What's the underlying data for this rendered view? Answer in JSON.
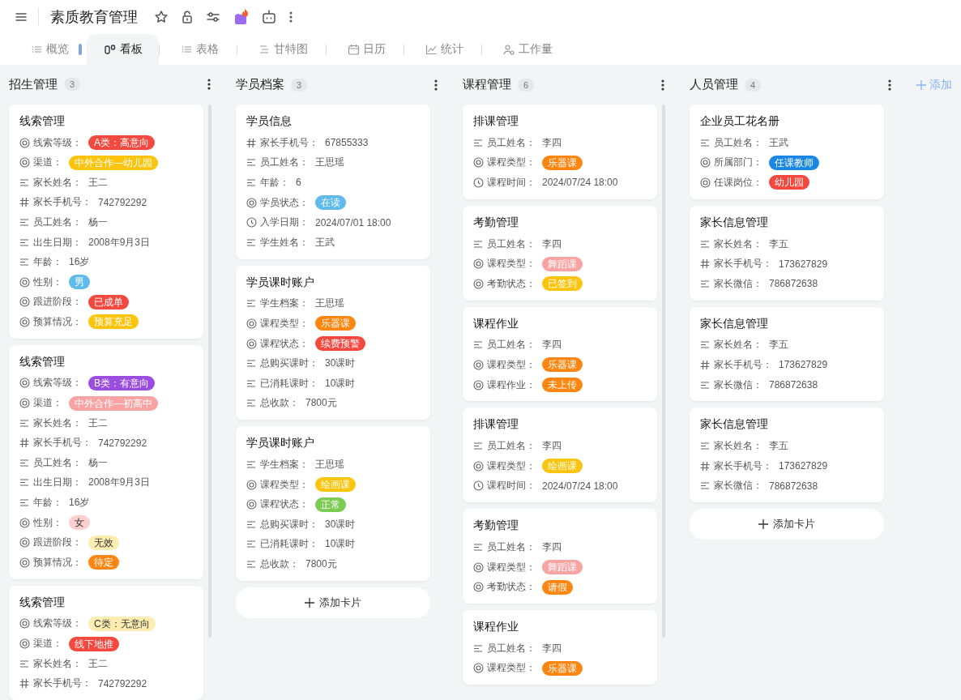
{
  "app": {
    "title": "素质教育管理"
  },
  "tabs": [
    {
      "label": "概览",
      "kind": "list",
      "selected": false
    },
    {
      "label": "看板",
      "kind": "board",
      "selected": true
    },
    {
      "label": "表格",
      "kind": "list",
      "selected": false
    },
    {
      "label": "甘特图",
      "kind": "gantt",
      "selected": false
    },
    {
      "label": "日历",
      "kind": "calendar",
      "selected": false
    },
    {
      "label": "统计",
      "kind": "chart",
      "selected": false
    },
    {
      "label": "工作量",
      "kind": "person",
      "selected": false
    }
  ],
  "columns": [
    {
      "title": "招生管理",
      "count": "3",
      "cards": [
        {
          "title": "线索管理",
          "fields": [
            {
              "kind": "select",
              "label": "线索等级：",
              "value": "A类：高意向",
              "color": "#f5483e"
            },
            {
              "kind": "select",
              "label": "渠道：",
              "value": "中外合作—幼儿园",
              "color": "#fcc40d"
            },
            {
              "kind": "text",
              "label": "家长姓名：",
              "value": "王二"
            },
            {
              "kind": "number",
              "label": "家长手机号：",
              "value": "742792292"
            },
            {
              "kind": "text",
              "label": "员工姓名：",
              "value": "杨一"
            },
            {
              "kind": "text",
              "label": "出生日期：",
              "value": "2008年9月3日"
            },
            {
              "kind": "text",
              "label": "年龄：",
              "value": "16岁"
            },
            {
              "kind": "select",
              "label": "性别：",
              "value": "男",
              "color": "#5fbbeb"
            },
            {
              "kind": "select",
              "label": "跟进阶段：",
              "value": "已成单",
              "color": "#f5483e"
            },
            {
              "kind": "select",
              "label": "预算情况：",
              "value": "预算充足",
              "color": "#fcc40d"
            }
          ]
        },
        {
          "title": "线索管理",
          "fields": [
            {
              "kind": "select",
              "label": "线索等级：",
              "value": "B类：有意向",
              "color": "#9a4ddf"
            },
            {
              "kind": "select",
              "label": "渠道：",
              "value": "中外合作—初高中",
              "color": "#f9a3a3"
            },
            {
              "kind": "text",
              "label": "家长姓名：",
              "value": "王二"
            },
            {
              "kind": "number",
              "label": "家长手机号：",
              "value": "742792292"
            },
            {
              "kind": "text",
              "label": "员工姓名：",
              "value": "杨一"
            },
            {
              "kind": "text",
              "label": "出生日期：",
              "value": "2008年9月3日"
            },
            {
              "kind": "text",
              "label": "年龄：",
              "value": "16岁"
            },
            {
              "kind": "select",
              "label": "性别：",
              "value": "女",
              "color": "#fdd0cf"
            },
            {
              "kind": "select",
              "label": "跟进阶段：",
              "value": "无效",
              "color": "#fdedb1"
            },
            {
              "kind": "select",
              "label": "预算情况：",
              "value": "待定",
              "color": "#fe8611"
            }
          ]
        },
        {
          "title": "线索管理",
          "fields": [
            {
              "kind": "select",
              "label": "线索等级：",
              "value": "C类：无意向",
              "color": "#fdedb1"
            },
            {
              "kind": "select",
              "label": "渠道：",
              "value": "线下地推",
              "color": "#f5483e"
            },
            {
              "kind": "text",
              "label": "家长姓名：",
              "value": "王二"
            },
            {
              "kind": "number",
              "label": "家长手机号：",
              "value": "742792292"
            }
          ]
        }
      ]
    },
    {
      "title": "学员档案",
      "count": "3",
      "cards": [
        {
          "title": "学员信息",
          "fields": [
            {
              "kind": "number",
              "label": "家长手机号：",
              "value": "67855333"
            },
            {
              "kind": "text",
              "label": "员工姓名：",
              "value": "王思瑶"
            },
            {
              "kind": "text",
              "label": "年龄：",
              "value": "6"
            },
            {
              "kind": "select",
              "label": "学员状态：",
              "value": "在读",
              "color": "#5fbbeb"
            },
            {
              "kind": "date",
              "label": "入学日期：",
              "value": "2024/07/01 18:00"
            },
            {
              "kind": "text",
              "label": "学生姓名：",
              "value": "王武"
            }
          ]
        },
        {
          "title": "学员课时账户",
          "fields": [
            {
              "kind": "text",
              "label": "学生档案：",
              "value": "王思瑶"
            },
            {
              "kind": "select",
              "label": "课程类型：",
              "value": "乐器课",
              "color": "#fe8611"
            },
            {
              "kind": "select",
              "label": "课程状态：",
              "value": "续费预警",
              "color": "#f5483e"
            },
            {
              "kind": "text",
              "label": "总购买课时：",
              "value": "30课时"
            },
            {
              "kind": "text",
              "label": "已消耗课时：",
              "value": "10课时"
            },
            {
              "kind": "text",
              "label": "总收款：",
              "value": "7800元"
            }
          ]
        },
        {
          "title": "学员课时账户",
          "fields": [
            {
              "kind": "text",
              "label": "学生档案：",
              "value": "王思瑶"
            },
            {
              "kind": "select",
              "label": "课程类型：",
              "value": "绘画课",
              "color": "#fcc40d"
            },
            {
              "kind": "select",
              "label": "课程状态：",
              "value": "正常",
              "color": "#7ccb52"
            },
            {
              "kind": "text",
              "label": "总购买课时：",
              "value": "30课时"
            },
            {
              "kind": "text",
              "label": "已消耗课时：",
              "value": "10课时"
            },
            {
              "kind": "text",
              "label": "总收款：",
              "value": "7800元"
            }
          ]
        }
      ],
      "add_card": "添加卡片"
    },
    {
      "title": "课程管理",
      "count": "6",
      "cards": [
        {
          "title": "排课管理",
          "fields": [
            {
              "kind": "text",
              "label": "员工姓名：",
              "value": "李四"
            },
            {
              "kind": "select",
              "label": "课程类型：",
              "value": "乐器课",
              "color": "#fe8611"
            },
            {
              "kind": "date",
              "label": "课程时间：",
              "value": "2024/07/24 18:00"
            }
          ]
        },
        {
          "title": "考勤管理",
          "fields": [
            {
              "kind": "text",
              "label": "员工姓名：",
              "value": "李四"
            },
            {
              "kind": "select",
              "label": "课程类型：",
              "value": "舞蹈课",
              "color": "#f9a3a3"
            },
            {
              "kind": "select",
              "label": "考勤状态：",
              "value": "已签到",
              "color": "#fcc40d"
            }
          ]
        },
        {
          "title": "课程作业",
          "fields": [
            {
              "kind": "text",
              "label": "员工姓名：",
              "value": "李四"
            },
            {
              "kind": "select",
              "label": "课程类型：",
              "value": "乐器课",
              "color": "#fe8611"
            },
            {
              "kind": "select",
              "label": "课程作业：",
              "value": "未上传",
              "color": "#fe8611"
            }
          ]
        },
        {
          "title": "排课管理",
          "fields": [
            {
              "kind": "text",
              "label": "员工姓名：",
              "value": "李四"
            },
            {
              "kind": "select",
              "label": "课程类型：",
              "value": "绘画课",
              "color": "#fcc40d"
            },
            {
              "kind": "date",
              "label": "课程时间：",
              "value": "2024/07/24 18:00"
            }
          ]
        },
        {
          "title": "考勤管理",
          "fields": [
            {
              "kind": "text",
              "label": "员工姓名：",
              "value": "李四"
            },
            {
              "kind": "select",
              "label": "课程类型：",
              "value": "舞蹈课",
              "color": "#f9a3a3"
            },
            {
              "kind": "select",
              "label": "考勤状态：",
              "value": "请假",
              "color": "#fe8611"
            }
          ]
        },
        {
          "title": "课程作业",
          "fields": [
            {
              "kind": "text",
              "label": "员工姓名：",
              "value": "李四"
            },
            {
              "kind": "select",
              "label": "课程类型：",
              "value": "乐器课",
              "color": "#fe8611"
            }
          ]
        }
      ]
    },
    {
      "title": "人员管理",
      "count": "4",
      "cards": [
        {
          "title": "企业员工花名册",
          "fields": [
            {
              "kind": "text",
              "label": "员工姓名：",
              "value": "王武"
            },
            {
              "kind": "select",
              "label": "所属部门：",
              "value": "任课教师",
              "color": "#1b87e4"
            },
            {
              "kind": "select",
              "label": "任课岗位：",
              "value": "幼儿园",
              "color": "#f5483e"
            }
          ]
        },
        {
          "title": "家长信息管理",
          "fields": [
            {
              "kind": "text",
              "label": "家长姓名：",
              "value": "李五"
            },
            {
              "kind": "number",
              "label": "家长手机号：",
              "value": "173627829"
            },
            {
              "kind": "text",
              "label": "家长微信：",
              "value": "786872638"
            }
          ]
        },
        {
          "title": "家长信息管理",
          "fields": [
            {
              "kind": "text",
              "label": "家长姓名：",
              "value": "李五"
            },
            {
              "kind": "number",
              "label": "家长手机号：",
              "value": "173627829"
            },
            {
              "kind": "text",
              "label": "家长微信：",
              "value": "786872638"
            }
          ]
        },
        {
          "title": "家长信息管理",
          "fields": [
            {
              "kind": "text",
              "label": "家长姓名：",
              "value": "李五"
            },
            {
              "kind": "number",
              "label": "家长手机号：",
              "value": "173627829"
            },
            {
              "kind": "text",
              "label": "家长微信：",
              "value": "786872638"
            }
          ]
        }
      ],
      "add_card": "添加卡片"
    }
  ],
  "add_column": "添加"
}
